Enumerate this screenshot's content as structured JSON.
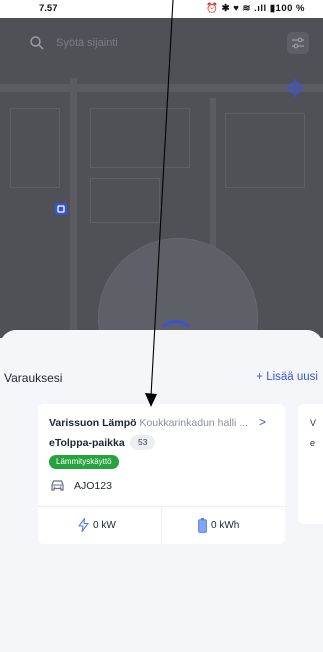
{
  "status_bar": {
    "time": "7.57",
    "icons": "⏰ ✱ ♥ ≋ .ıll ▮100 %"
  },
  "map": {
    "search_placeholder": "Syötä sijainti"
  },
  "reservations": {
    "title": "Varauksesi",
    "add_new": "+ Lisää uusi",
    "card": {
      "location_name": "Varissuon Lämpö",
      "location_address": "Koukkarinkadun halli ...",
      "chevron": ">",
      "spot_type": "eTolppa-paikka",
      "spot_count": "53",
      "usage_badge": "Lämmityskäyttö",
      "plate": "AJO123",
      "power": "0 kW",
      "energy": "0 kWh"
    },
    "next_card": {
      "line1": "V",
      "line2": "e"
    }
  },
  "colors": {
    "accent": "#3953d6",
    "badge_green": "#26a33c",
    "map_overlay": "#4f5156"
  }
}
